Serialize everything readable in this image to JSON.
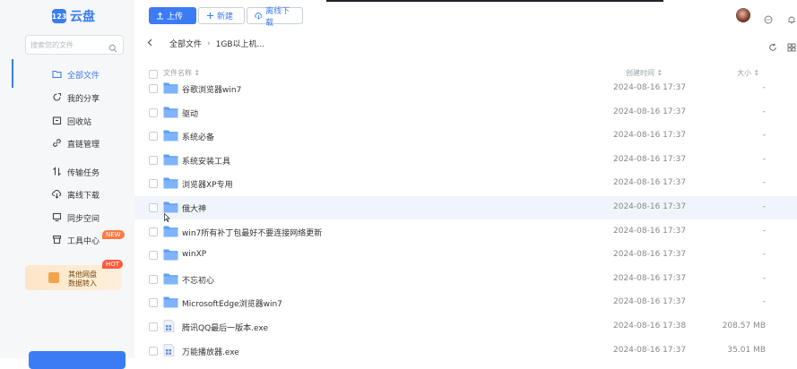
{
  "app": {
    "logo_mark": "123",
    "logo_text": "云盘"
  },
  "search": {
    "placeholder": "搜索您的文件"
  },
  "sidebar": {
    "items": [
      {
        "label": "全部文件",
        "icon": "folder-icon"
      },
      {
        "label": "我的分享",
        "icon": "share-icon"
      },
      {
        "label": "回收站",
        "icon": "trash-icon"
      },
      {
        "label": "直链管理",
        "icon": "link-icon"
      },
      {
        "label": "传输任务",
        "icon": "transfer-icon"
      },
      {
        "label": "离线下载",
        "icon": "cloud-download-icon"
      },
      {
        "label": "同步空间",
        "icon": "sync-icon"
      },
      {
        "label": "工具中心",
        "icon": "toolbox-icon"
      }
    ],
    "new_badge": "NEW",
    "promo": {
      "line1": "其他网盘",
      "line2": "数据转入",
      "badge": "HOT"
    }
  },
  "toolbar": {
    "upload": "上传",
    "new": "新建",
    "offline": "离线下载"
  },
  "breadcrumb": {
    "root": "全部文件",
    "current": "1GB以上机..."
  },
  "table": {
    "headers": {
      "name": "文件名称 ↕",
      "time": "创建时间 ↕",
      "size": "大小 ↕"
    },
    "rows": [
      {
        "name": "谷歌浏览器win7",
        "time": "2024-08-16 17:37",
        "size": "-",
        "type": "folder"
      },
      {
        "name": "驱动",
        "time": "2024-08-16 17:37",
        "size": "-",
        "type": "folder"
      },
      {
        "name": "系统必备",
        "time": "2024-08-16 17:37",
        "size": "-",
        "type": "folder"
      },
      {
        "name": "系统安装工具",
        "time": "2024-08-16 17:37",
        "size": "-",
        "type": "folder"
      },
      {
        "name": "浏览器XP专用",
        "time": "2024-08-16 17:37",
        "size": "-",
        "type": "folder"
      },
      {
        "name": "俄大神",
        "time": "2024-08-16 17:37",
        "size": "-",
        "type": "folder"
      },
      {
        "name": "win7所有补丁包最好不要连接网络更新",
        "time": "2024-08-16 17:37",
        "size": "-",
        "type": "folder"
      },
      {
        "name": "winXP",
        "time": "2024-08-16 17:37",
        "size": "-",
        "type": "folder"
      },
      {
        "name": "不忘初心",
        "time": "2024-08-16 17:37",
        "size": "-",
        "type": "folder"
      },
      {
        "name": "MicrosoftEdge浏览器win7",
        "time": "2024-08-16 17:37",
        "size": "-",
        "type": "folder"
      },
      {
        "name": "腾讯QQ最后一版本.exe",
        "time": "2024-08-16 17:38",
        "size": "208.57 MB",
        "type": "exe"
      },
      {
        "name": "万能播放器.exe",
        "time": "2024-08-16 17:37",
        "size": "35.01 MB",
        "type": "exe"
      }
    ]
  },
  "colors": {
    "accent": "#3b7cf5",
    "folder": "#5b9cf5"
  }
}
